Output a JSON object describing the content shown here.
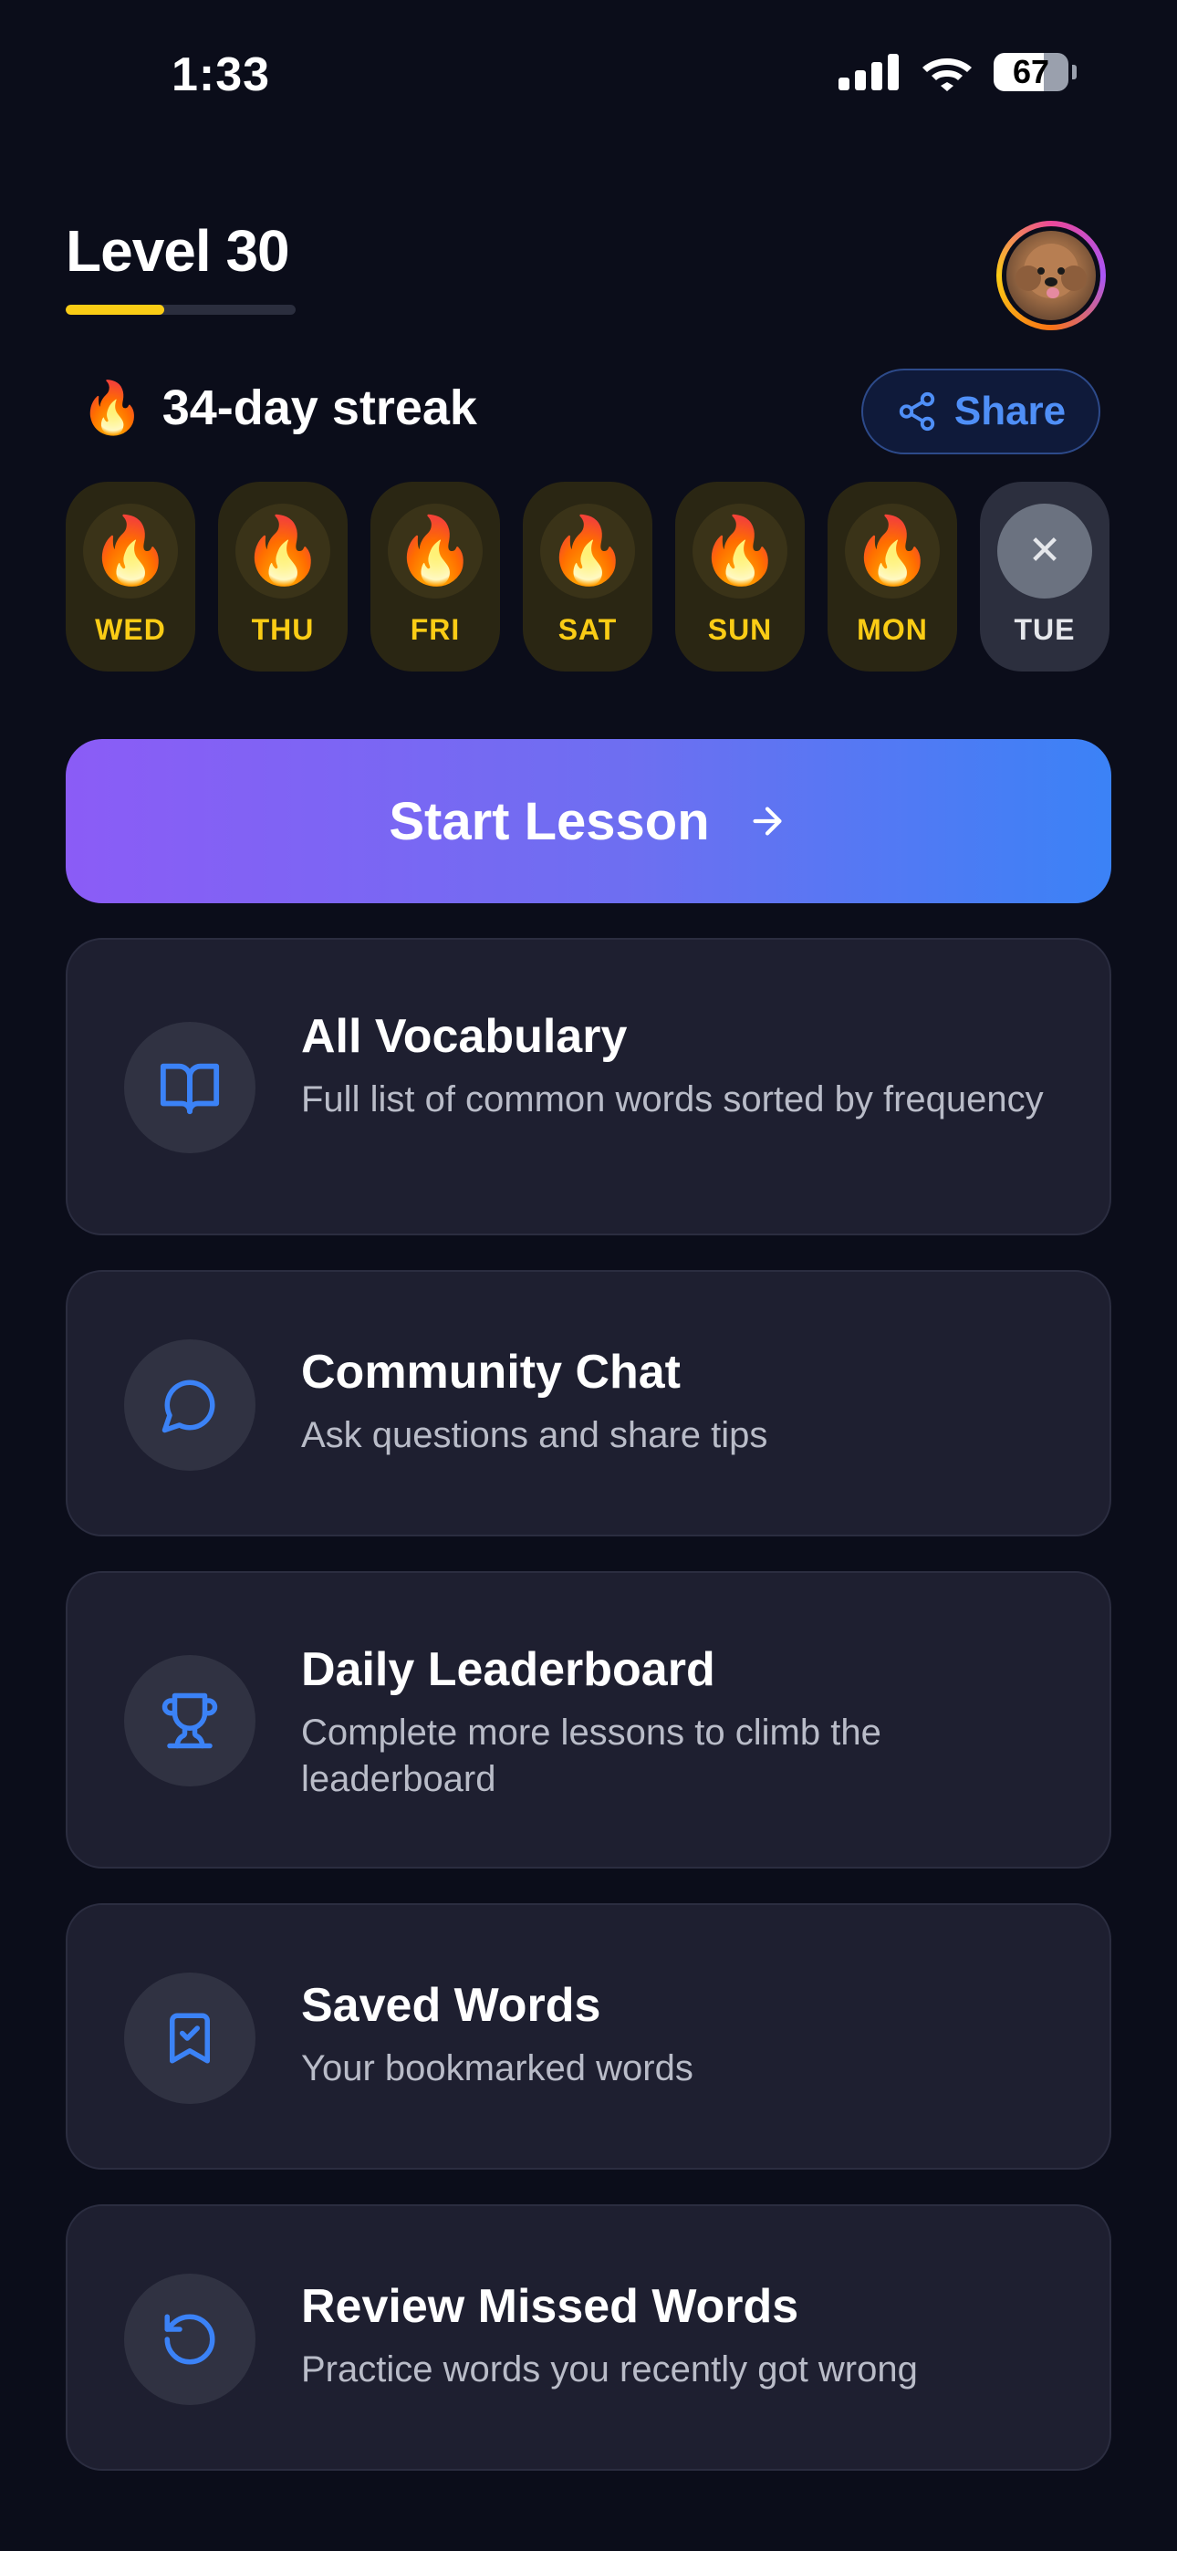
{
  "status_bar": {
    "time": "1:33",
    "battery_level": "67",
    "battery_fraction": 0.67
  },
  "header": {
    "level_title": "Level 30",
    "level_progress": 0.43
  },
  "streak": {
    "flame": "🔥",
    "text": "34-day streak",
    "share_label": "Share"
  },
  "days": [
    {
      "label": "WED",
      "icon": "🔥",
      "status": "done"
    },
    {
      "label": "THU",
      "icon": "🔥",
      "status": "done"
    },
    {
      "label": "FRI",
      "icon": "🔥",
      "status": "done"
    },
    {
      "label": "SAT",
      "icon": "🔥",
      "status": "done"
    },
    {
      "label": "SUN",
      "icon": "🔥",
      "status": "done"
    },
    {
      "label": "MON",
      "icon": "🔥",
      "status": "done"
    },
    {
      "label": "TUE",
      "icon": "✕",
      "status": "missed"
    }
  ],
  "start_lesson": {
    "label": "Start Lesson"
  },
  "cards": [
    {
      "icon": "book-open-icon",
      "title": "All Vocabulary",
      "desc": "Full list of common words sorted by frequency"
    },
    {
      "icon": "chat-bubble-icon",
      "title": "Community Chat",
      "desc": "Ask questions and share tips"
    },
    {
      "icon": "trophy-icon",
      "title": "Daily Leaderboard",
      "desc": "Complete more lessons to climb the leaderboard"
    },
    {
      "icon": "bookmark-check-icon",
      "title": "Saved Words",
      "desc": "Your bookmarked words"
    },
    {
      "icon": "rotate-ccw-icon",
      "title": "Review Missed Words",
      "desc": "Practice words you recently got wrong"
    }
  ],
  "colors": {
    "background": "#0b0d1a",
    "accent_blue": "#3b82f6",
    "streak_yellow": "#facc15",
    "card_bg": "#1e1f30"
  }
}
